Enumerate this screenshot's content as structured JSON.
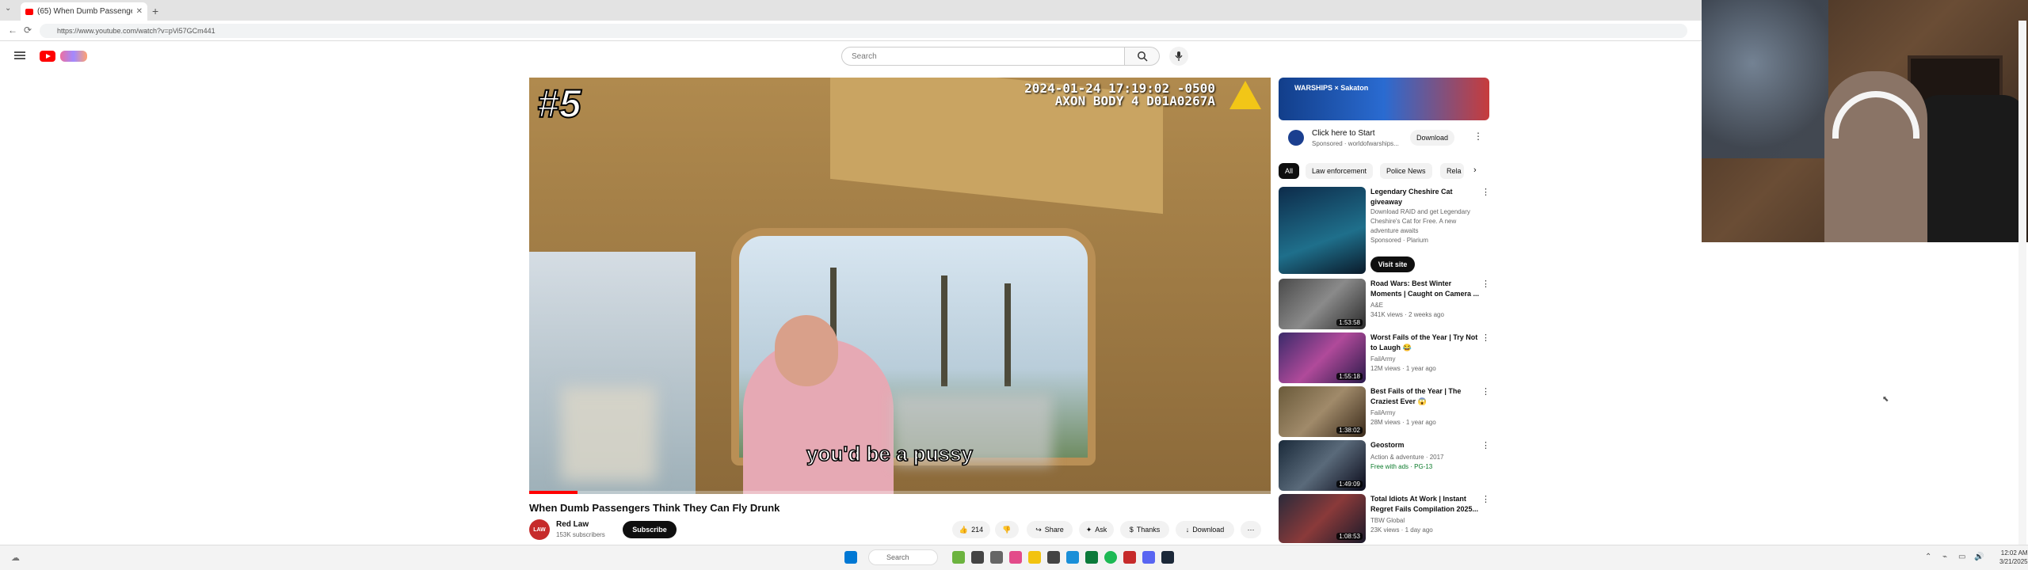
{
  "browser": {
    "tab_title": "(65) When Dumb Passenge",
    "new_tab": "+",
    "url": "https://www.youtube.com/watch?v=pVi57GCm441",
    "back": "←",
    "reload": "⟳"
  },
  "header": {
    "search_placeholder": "Search"
  },
  "player": {
    "rank_overlay": "#5",
    "timestamp_line1": "2024-01-24 17:19:02 -0500",
    "timestamp_line2": "AXON BODY 4 D01A0267A",
    "subtitle": "you'd be a pussy",
    "progress_fraction": 0.065
  },
  "video": {
    "title": "When Dumb Passengers Think They Can Fly Drunk",
    "channel_name": "Red Law",
    "channel_avatar_text": "LAW",
    "subscribers": "153K subscribers",
    "subscribe_label": "Subscribe",
    "likes": "214",
    "share_label": "Share",
    "ask_label": "Ask",
    "thanks_label": "Thanks",
    "download_label": "Download",
    "more": "⋯"
  },
  "sidebar": {
    "ad_banner_text": "WARSHIPS × Sakaton",
    "ad_title": "Click here to Start",
    "ad_sponsor": "Sponsored · worldofwarships...",
    "ad_button": "Download",
    "chips": [
      "All",
      "Law enforcement",
      "Police News",
      "Rela"
    ],
    "items": [
      {
        "title": "Legendary Cheshire Cat giveaway",
        "meta1": "Download RAID and get Legendary",
        "meta2": "Cheshire's Cat for Free. A new",
        "meta3": "adventure awaits",
        "meta4": "Sponsored · Plarium",
        "cta": "Visit site",
        "duration": ""
      },
      {
        "title": "Road Wars: Best Winter Moments | Caught on Camera ...",
        "meta1": "A&E",
        "meta2": "341K views · 2 weeks ago",
        "meta3": "",
        "meta4": "",
        "cta": "",
        "duration": "1:53:58"
      },
      {
        "title": "Worst Fails of the Year | Try Not to Laugh 😂",
        "meta1": "FailArmy",
        "meta2": "12M views · 1 year ago",
        "meta3": "",
        "meta4": "",
        "cta": "",
        "duration": "1:55:18"
      },
      {
        "title": "Best Fails of the Year | The Craziest Ever 😱",
        "meta1": "FailArmy",
        "meta2": "28M views · 1 year ago",
        "meta3": "",
        "meta4": "",
        "cta": "",
        "duration": "1:38:02"
      },
      {
        "title": "Geostorm",
        "meta1": "Action & adventure · 2017",
        "meta2": "Free with ads · PG-13",
        "meta3": "",
        "meta4": "",
        "cta": "",
        "duration": "1:49:09"
      },
      {
        "title": "Total Idiots At Work | Instant Regret Fails Compilation 2025...",
        "meta1": "TBW Global",
        "meta2": "23K views · 1 day ago",
        "meta3": "",
        "meta4": "",
        "cta": "",
        "duration": "1:08:53"
      }
    ]
  },
  "taskbar": {
    "search_label": "Search",
    "time": "12:02 AM",
    "date": "3/21/2025"
  },
  "colors": {
    "yt_red": "#ff0000",
    "subscribe_bg": "#0f0f0f",
    "chip_bg": "#f2f2f2"
  }
}
